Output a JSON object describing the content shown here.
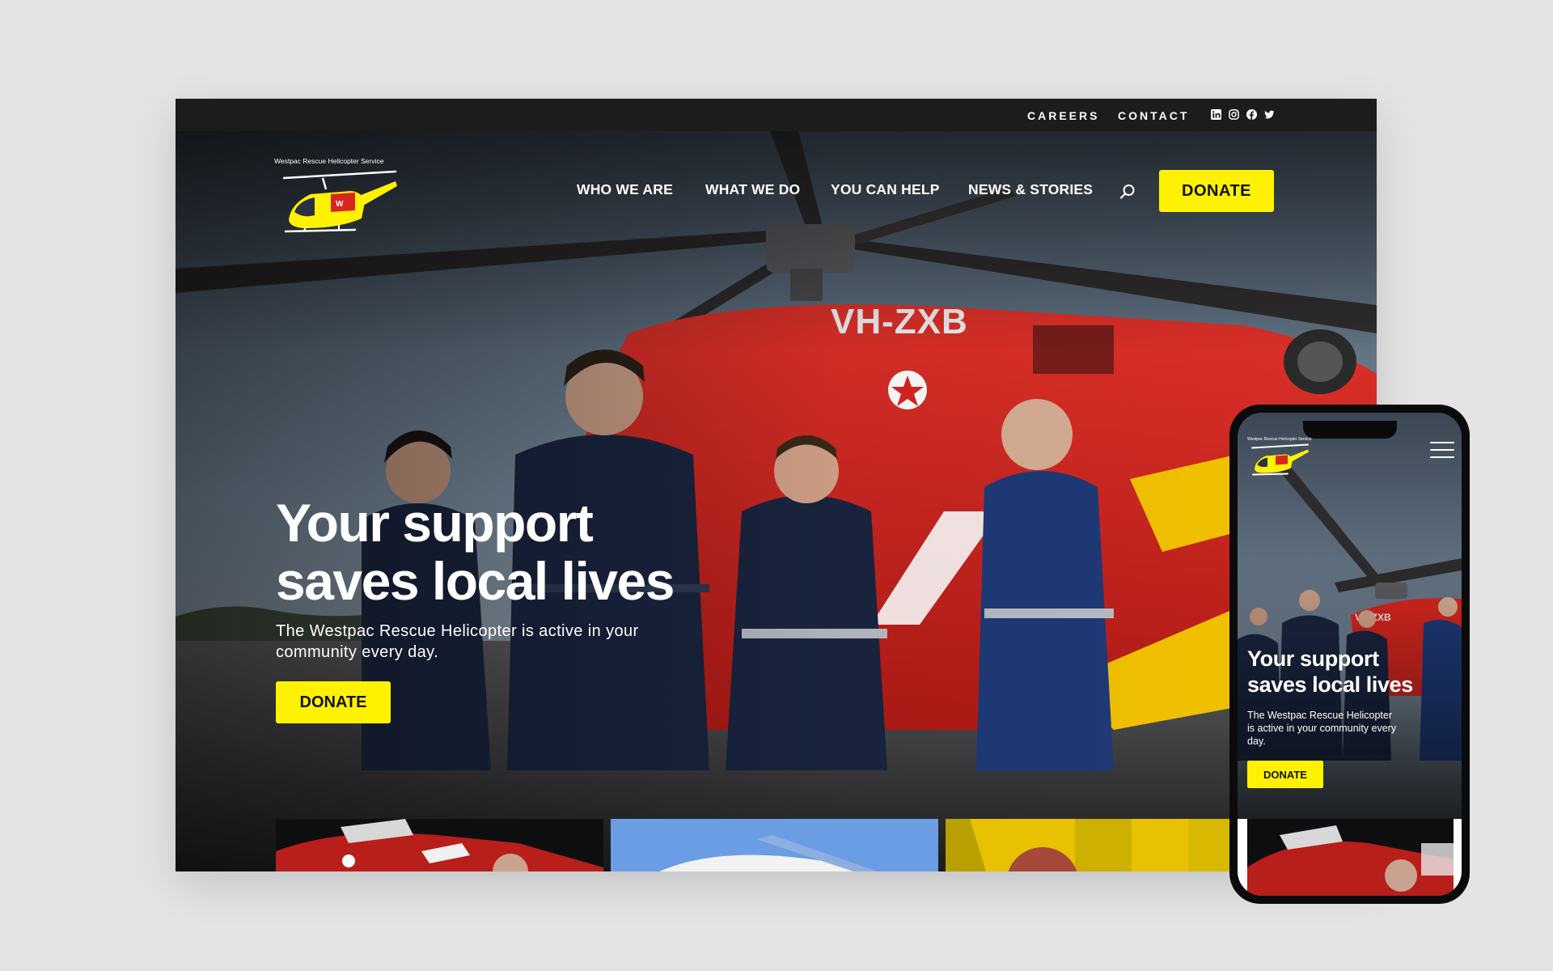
{
  "colors": {
    "accent_yellow": "#fff200",
    "topbar": "#1c1c1c",
    "brand_red": "#d8261f",
    "page_bg": "#e4e4e4"
  },
  "topbar": {
    "links": [
      "CAREERS",
      "CONTACT"
    ],
    "social_icons": [
      "linkedin-icon",
      "instagram-icon",
      "facebook-icon",
      "twitter-icon"
    ]
  },
  "header": {
    "logo_text": "Westpac Rescue Helicopter Service",
    "nav": [
      "WHO WE ARE",
      "WHAT WE DO",
      "YOU CAN HELP",
      "NEWS & STORIES"
    ],
    "search_icon": "search-icon",
    "donate_label": "DONATE"
  },
  "hero": {
    "title_line1": "Your support",
    "title_line2": "saves local lives",
    "subtitle": "The Westpac Rescue Helicopter is active in your community every day.",
    "donate_label": "DONATE",
    "helicopter_registration": "VH-ZXB"
  },
  "mobile": {
    "logo_text": "Westpac Rescue Helicopter Service",
    "menu_icon": "hamburger-menu-icon",
    "title_line1": "Your support",
    "title_line2": "saves local lives",
    "subtitle": "The Westpac Rescue Helicopter is active in your community every day.",
    "donate_label": "DONATE",
    "helicopter_registration": "VH-ZXB"
  }
}
